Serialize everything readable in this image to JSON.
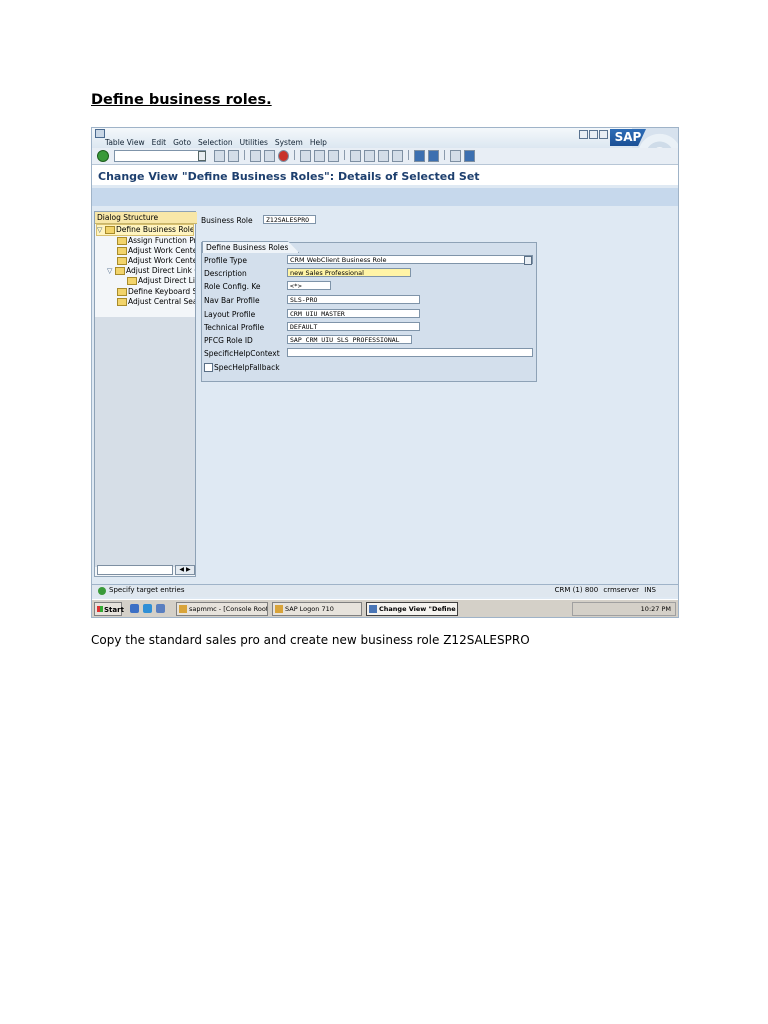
{
  "document": {
    "heading": "Define business roles.",
    "caption": "Copy the standard sales pro and create new business role Z12SALESPRO"
  },
  "menu": [
    "Table View",
    "Edit",
    "Goto",
    "Selection",
    "Utilities",
    "System",
    "Help"
  ],
  "brand": "SAP",
  "view_title": "Change View \"Define Business Roles\": Details of Selected Set",
  "tree": {
    "header": "Dialog Structure",
    "items": [
      "Define Business Roles",
      "Assign Function Prof",
      "Adjust Work Centers",
      "Adjust Work Center G",
      "Adjust Direct Link Gro",
      "Adjust Direct Link",
      "Define Keyboard Sho",
      "Adjust Central Searc"
    ]
  },
  "business_role": {
    "label": "Business Role",
    "value": "Z12SALESPRO"
  },
  "group_title": "Define Business Roles",
  "fields": {
    "profile_type": {
      "label": "Profile Type",
      "value": "CRM WebClient Business Role"
    },
    "description": {
      "label": "Description",
      "value": "new Sales Professional"
    },
    "role_config": {
      "label": "Role Config. Ke",
      "value": "<*>"
    },
    "nav_bar": {
      "label": "Nav Bar Profile",
      "value": "SLS-PRO"
    },
    "layout": {
      "label": "Layout Profile",
      "value": "CRM_UIU_MASTER"
    },
    "technical": {
      "label": "Technical Profile",
      "value": "DEFAULT"
    },
    "pfcg": {
      "label": "PFCG Role ID",
      "value": "SAP_CRM_UIU_SLS_PROFESSIONAL"
    },
    "spec_help": {
      "label": "SpecificHelpContext",
      "value": ""
    },
    "fallback": {
      "label": "SpecHelpFallback"
    }
  },
  "status": {
    "message": "Specify target entries",
    "system": "CRM (1) 800",
    "server": "crmserver",
    "mode": "INS"
  },
  "taskbar": {
    "start": "Start",
    "tasks": [
      "sapmmc - [Console Root\\...",
      "SAP Logon 710",
      "Change View \"Define ..."
    ],
    "clock": "10:27 PM"
  }
}
